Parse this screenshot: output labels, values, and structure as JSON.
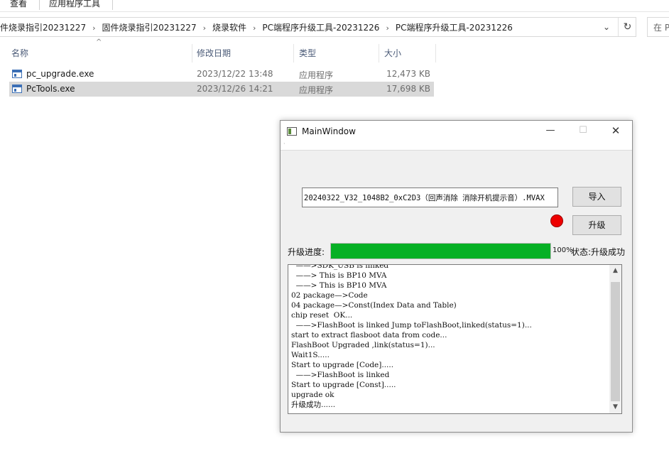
{
  "ribbon": {
    "tab_view": "查看",
    "tab_app_tools": "应用程序工具"
  },
  "address": {
    "crumbs": [
      "件烧录指引20231227",
      "固件烧录指引20231227",
      "烧录软件",
      "PC端程序升级工具-20231226",
      "PC端程序升级工具-20231226"
    ],
    "search_placeholder": "在 P"
  },
  "columns": {
    "name": "名称",
    "date": "修改日期",
    "type": "类型",
    "size": "大小"
  },
  "files": [
    {
      "name": "pc_upgrade.exe",
      "date": "2023/12/22 13:48",
      "type": "应用程序",
      "size": "12,473 KB",
      "selected": false
    },
    {
      "name": "PcTools.exe",
      "date": "2023/12/26 14:21",
      "type": "应用程序",
      "size": "17,698 KB",
      "selected": true
    }
  ],
  "window": {
    "title": "MainWindow",
    "file_path": "20240322_V32_1048B2_0xC2D3（回声消除  消除开机提示音）.MVAX",
    "import_label": "导入",
    "upgrade_label": "升级",
    "indicator_color": "#ee0000",
    "progress_label": "升级进度:",
    "progress_value": 100,
    "progress_text": "100%",
    "status_label": "状态:",
    "status_value": "升级成功",
    "log_lines": [
      "  ——>SDK_USB is linked",
      "  ——> This is BP10 MVA",
      "  ——> This is BP10 MVA",
      "02 package—>Code",
      "04 package—>Const(Index Data and Table)",
      "chip reset  OK...",
      "  ——>FlashBoot is linked Jump toFlashBoot,linked(status=1)...",
      "start to extract flasboot data from code...",
      "FlashBoot Upgraded ,link(status=1)...",
      "Wait1S.....",
      "Start to upgrade [Code].....",
      "  ——>FlashBoot is linked",
      "Start to upgrade [Const].....",
      "upgrade ok",
      "升级成功......"
    ]
  }
}
